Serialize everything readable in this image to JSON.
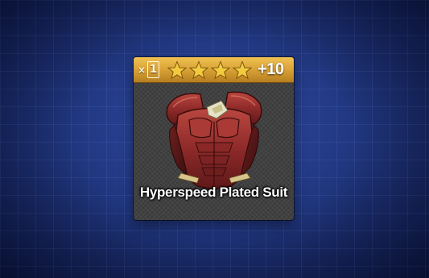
{
  "item": {
    "quantity_prefix": "×",
    "quantity": "1",
    "star_count": 4,
    "upgrade_level": "+10",
    "name": "Hyperspeed Plated Suit"
  },
  "colors": {
    "header_gold": "#d9a236",
    "star_gold": "#f3c93e",
    "armor_red": "#8e2a2a",
    "background_blue": "#233a86"
  },
  "icons": {
    "star": "star-icon",
    "armor": "armor-chest-icon"
  }
}
